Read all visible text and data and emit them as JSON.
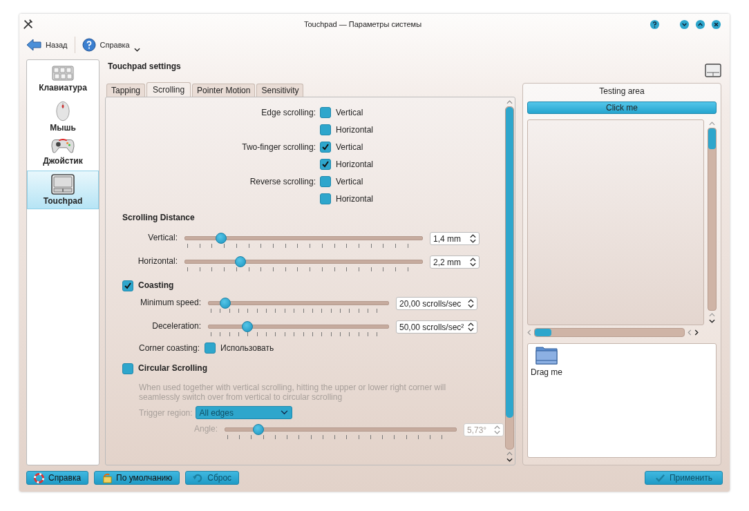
{
  "window": {
    "title": "Touchpad — Параметры системы"
  },
  "toolbar": [
    {
      "label": "Назад",
      "kind": "back"
    },
    {
      "label": "Справка",
      "kind": "help"
    }
  ],
  "sidebar": {
    "items": [
      {
        "label": "Клавиатура",
        "kind": "keyboard",
        "selected": false
      },
      {
        "label": "Мышь",
        "kind": "mouse",
        "selected": false
      },
      {
        "label": "Джойстик",
        "kind": "joystick",
        "selected": false
      },
      {
        "label": "Touchpad",
        "kind": "touchpad",
        "selected": true
      }
    ]
  },
  "header": "Touchpad settings",
  "tabs": [
    {
      "label": "Tapping",
      "selected": false
    },
    {
      "label": "Scrolling",
      "selected": true
    },
    {
      "label": "Pointer Motion",
      "selected": false
    },
    {
      "label": "Sensitivity",
      "selected": false
    }
  ],
  "scroll_options": [
    {
      "label": "Edge scrolling:",
      "options": [
        {
          "label": "Vertical",
          "checked": false
        },
        {
          "label": "Horizontal",
          "checked": false
        }
      ]
    },
    {
      "label": "Two-finger scrolling:",
      "options": [
        {
          "label": "Vertical",
          "checked": true
        },
        {
          "label": "Horizontal",
          "checked": true
        }
      ]
    },
    {
      "label": "Reverse scrolling:",
      "options": [
        {
          "label": "Vertical",
          "checked": false
        },
        {
          "label": "Horizontal",
          "checked": false
        }
      ]
    }
  ],
  "scrolling_distance": {
    "title": "Scrolling Distance",
    "sliders": [
      {
        "label": "Vertical:",
        "level": 0.15,
        "reading": "1,4 mm"
      },
      {
        "label": "Horizontal:",
        "level": 0.23,
        "reading": "2,2 mm"
      }
    ]
  },
  "coasting": {
    "label": "Coasting",
    "checked": true,
    "sliders": [
      {
        "label": "Minimum speed:",
        "level": 0.09,
        "reading": "20,00 scrolls/sec"
      },
      {
        "label": "Deceleration:",
        "level": 0.21,
        "reading": "50,00 scrolls/sec²"
      }
    ],
    "corner": {
      "label": "Corner coasting:",
      "option": "Использовать",
      "checked": false
    }
  },
  "circular": {
    "label": "Circular Scrolling",
    "checked": false,
    "disabled": true,
    "description": "When used together with vertical scrolling, hitting the upper or lower right corner will seamlessly switch over from vertical to circular scrolling",
    "trigger": {
      "label": "Trigger region:",
      "value": "All edges"
    },
    "angle": {
      "label": "Angle:",
      "level": 0.14,
      "reading": "5,73°"
    }
  },
  "testing_area": {
    "title": "Testing area",
    "button": "Click me",
    "drag_item": "Drag me"
  },
  "buttons": [
    {
      "label": "Справка",
      "kind": "help",
      "disabled": false
    },
    {
      "label": "По умолчанию",
      "kind": "defaults",
      "disabled": false
    },
    {
      "label": "Сброс",
      "kind": "reset",
      "disabled": true
    },
    {
      "label": "Применить",
      "kind": "apply",
      "disabled": true
    }
  ]
}
